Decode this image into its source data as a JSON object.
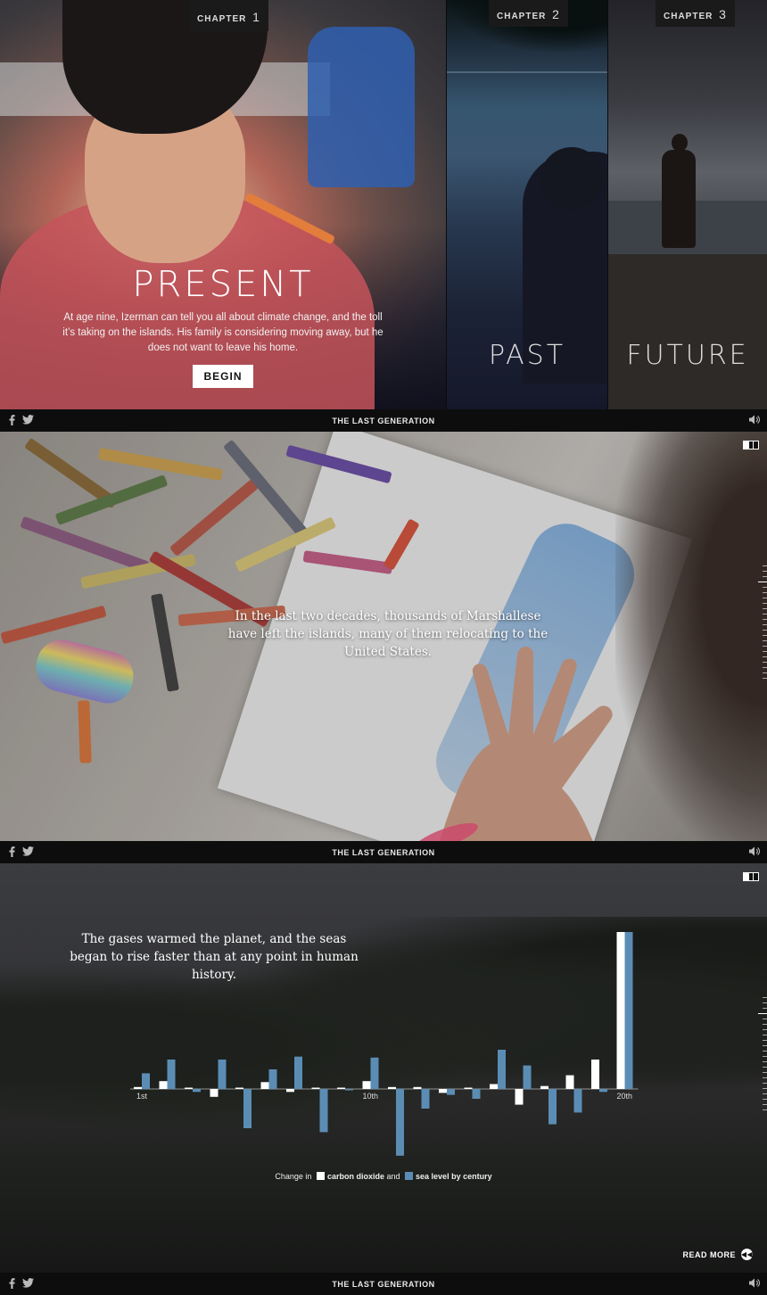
{
  "site": {
    "title": "THE LAST GENERATION"
  },
  "chapters": [
    {
      "tag": "CHAPTER",
      "number": "1",
      "title": "PRESENT",
      "description": "At age nine, Izerman can tell you all about climate change, and the toll it’s taking on the islands. His family is considering moving away, but he does not want to leave his home.",
      "button": "BEGIN"
    },
    {
      "tag": "CHAPTER",
      "number": "2",
      "title": "PAST"
    },
    {
      "tag": "CHAPTER",
      "number": "3",
      "title": "FUTURE"
    }
  ],
  "icons": {
    "facebook": "facebook-icon",
    "twitter": "twitter-icon",
    "sound": "speaker-icon",
    "pages": "page-indicator-icon",
    "rewind": "rewind-icon"
  },
  "section2": {
    "caption": "In the last two decades, thousands of Marshallese have left the islands, many of them relocating to the United States."
  },
  "section3": {
    "caption": "The gases warmed the planet, and the seas began to rise faster than at any point in human history.",
    "legend": {
      "prefix": "Change in",
      "series1": "carbon dioxide",
      "joiner": "and",
      "series2": "sea level",
      "suffix": "by century"
    },
    "read_more": "READ MORE"
  },
  "colors": {
    "co2": "#ffffff",
    "sea": "#5b8db4"
  },
  "chart_data": {
    "type": "bar",
    "categories": [
      "1st",
      "2nd",
      "3rd",
      "4th",
      "5th",
      "6th",
      "7th",
      "8th",
      "9th",
      "10th",
      "11th",
      "12th",
      "13th",
      "14th",
      "15th",
      "16th",
      "17th",
      "18th",
      "19th",
      "20th"
    ],
    "tick_labels": {
      "1st": "1st",
      "10th": "10th",
      "20th": "20th"
    },
    "series": [
      {
        "name": "carbon dioxide",
        "color": "#ffffff",
        "values": [
          1,
          4,
          0.5,
          -4,
          0.5,
          3.5,
          -1.5,
          0.5,
          0.5,
          4,
          1,
          1,
          -2,
          0.5,
          2.5,
          -8,
          1.5,
          7,
          15,
          80
        ]
      },
      {
        "name": "sea level",
        "color": "#5b8db4",
        "values": [
          8,
          15,
          -1.5,
          15,
          -20,
          10,
          16.5,
          -22,
          -0.5,
          16,
          -34,
          -10,
          -3,
          -5,
          20,
          12,
          -18,
          -12,
          -1.5,
          80
        ]
      }
    ],
    "ylim": [
      -40,
      85
    ],
    "xlabel": "",
    "ylabel": ""
  }
}
